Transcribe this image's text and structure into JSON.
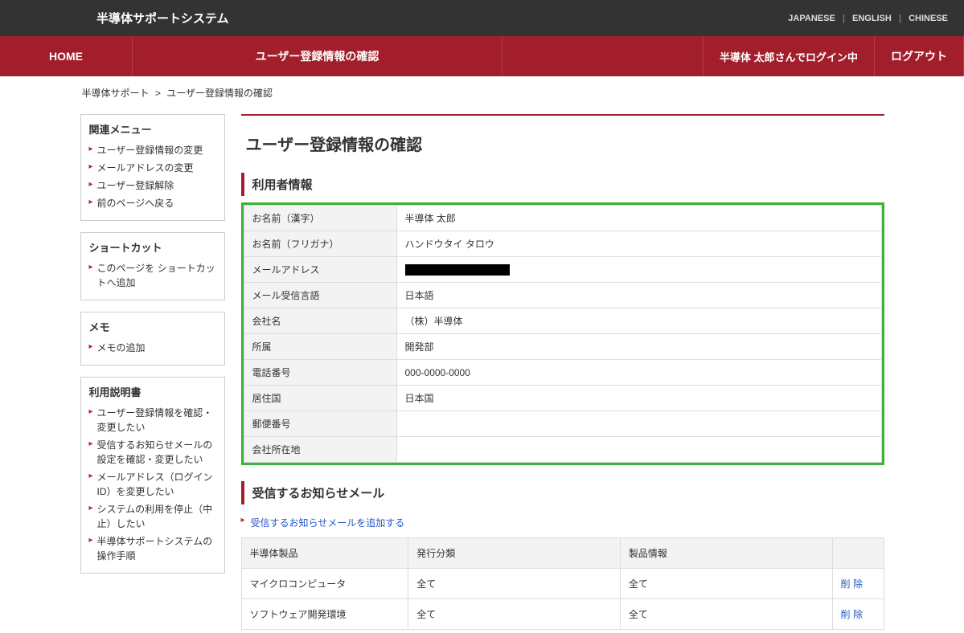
{
  "header": {
    "system_title": "半導体サポートシステム",
    "lang": {
      "jp": "JAPANESE",
      "en": "ENGLISH",
      "cn": "CHINESE"
    }
  },
  "nav": {
    "home": "HOME",
    "current": "ユーザー登録情報の確認",
    "login_status": "半導体 太郎さんでログイン中",
    "logout": "ログアウト"
  },
  "breadcrumb": {
    "root": "半導体サポート",
    "sep": ">",
    "current": "ユーザー登録情報の確認"
  },
  "sidebar": {
    "related": {
      "title": "関連メニュー",
      "items": [
        "ユーザー登録情報の変更",
        "メールアドレスの変更",
        "ユーザー登録解除",
        "前のページへ戻る"
      ]
    },
    "shortcut": {
      "title": "ショートカット",
      "items": [
        "このページを ショートカットへ追加"
      ]
    },
    "memo": {
      "title": "メモ",
      "items": [
        "メモの追加"
      ]
    },
    "manual": {
      "title": "利用説明書",
      "items": [
        "ユーザー登録情報を確認・変更したい",
        "受信するお知らせメールの設定を確認・変更したい",
        "メールアドレス（ログインID）を変更したい",
        "システムの利用を停止（中止）したい",
        "半導体サポートシステムの操作手順"
      ]
    }
  },
  "main": {
    "page_title": "ユーザー登録情報の確認",
    "user_info_heading": "利用者情報",
    "rows": [
      {
        "label": "お名前（漢字）",
        "value": "半導体 太郎"
      },
      {
        "label": "お名前（フリガナ）",
        "value": "ハンドウタイ タロウ"
      },
      {
        "label": "メールアドレス",
        "value": ""
      },
      {
        "label": "メール受信言語",
        "value": "日本語"
      },
      {
        "label": "会社名",
        "value": "（株）半導体"
      },
      {
        "label": "所属",
        "value": "開発部"
      },
      {
        "label": "電話番号",
        "value": "000-0000-0000"
      },
      {
        "label": "居住国",
        "value": "日本国"
      },
      {
        "label": "郵便番号",
        "value": ""
      },
      {
        "label": "会社所在地",
        "value": ""
      }
    ],
    "mail_heading": "受信するお知らせメール",
    "mail_add": "受信するお知らせメールを追加する",
    "mail_table": {
      "headers": [
        "半導体製品",
        "発行分類",
        "製品情報",
        ""
      ],
      "rows": [
        {
          "product": "マイクロコンピュータ",
          "category": "全て",
          "info": "全て",
          "action": "削除"
        },
        {
          "product": "ソフトウェア開発環境",
          "category": "全て",
          "info": "全て",
          "action": "削除"
        }
      ]
    }
  }
}
